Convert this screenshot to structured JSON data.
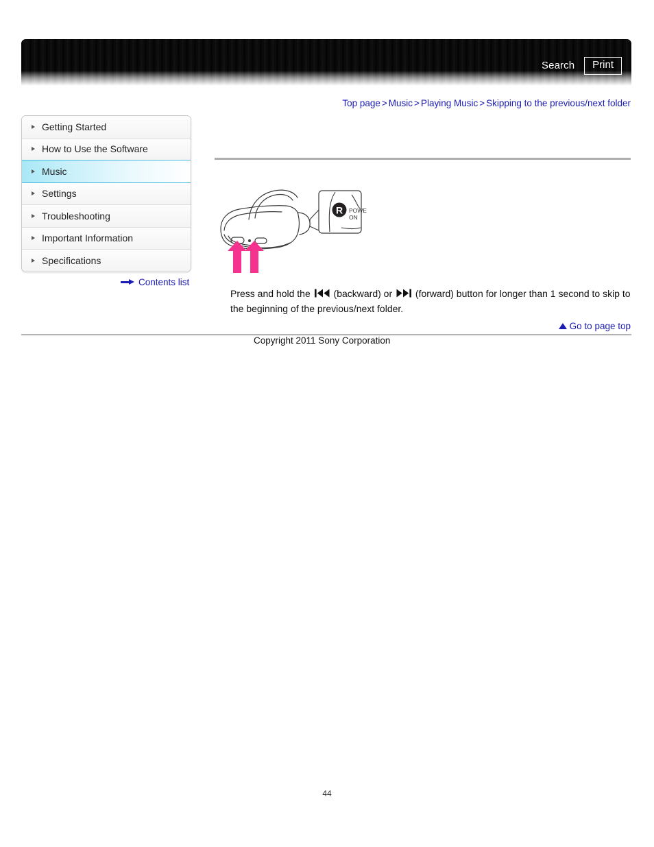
{
  "header": {
    "search_label": "Search",
    "print_label": "Print"
  },
  "breadcrumb": {
    "items": [
      {
        "label": "Top page"
      },
      {
        "label": "Music"
      },
      {
        "label": "Playing Music"
      },
      {
        "label": "Skipping to the previous/next folder"
      }
    ],
    "separator": ">"
  },
  "sidebar": {
    "items": [
      {
        "label": "Getting Started",
        "selected": false
      },
      {
        "label": "How to Use the Software",
        "selected": false
      },
      {
        "label": "Music",
        "selected": true
      },
      {
        "label": "Settings",
        "selected": false
      },
      {
        "label": "Troubleshooting",
        "selected": false
      },
      {
        "label": "Important Information",
        "selected": false
      },
      {
        "label": "Specifications",
        "selected": false
      }
    ]
  },
  "contents_link": {
    "label": "Contents list",
    "icon": "arrow-right-icon"
  },
  "figure": {
    "alt": "Headphone device with magnified callout of the R power-on marking and two pink arrows pointing at the backward and forward buttons",
    "callout_mark": "R",
    "callout_line1": "POWE",
    "callout_line2": "ON",
    "arrow_color": "#f5338e"
  },
  "body": {
    "text_part1": "Press and hold the",
    "glyph_backward": "⏮",
    "text_part2": "(backward) or",
    "glyph_forward": "⏭",
    "text_part3": "(forward) button for longer than 1 second to skip to the beginning of the previous/next folder."
  },
  "footer": {
    "go_top_label": "Go to page top",
    "copyright": "Copyright 2011 Sony Corporation",
    "page_number": "44"
  },
  "colors": {
    "link": "#1a1ab4",
    "accent_pink": "#f5338e",
    "selected_row": "#a9e8f7",
    "rule": "#aeaeae"
  }
}
